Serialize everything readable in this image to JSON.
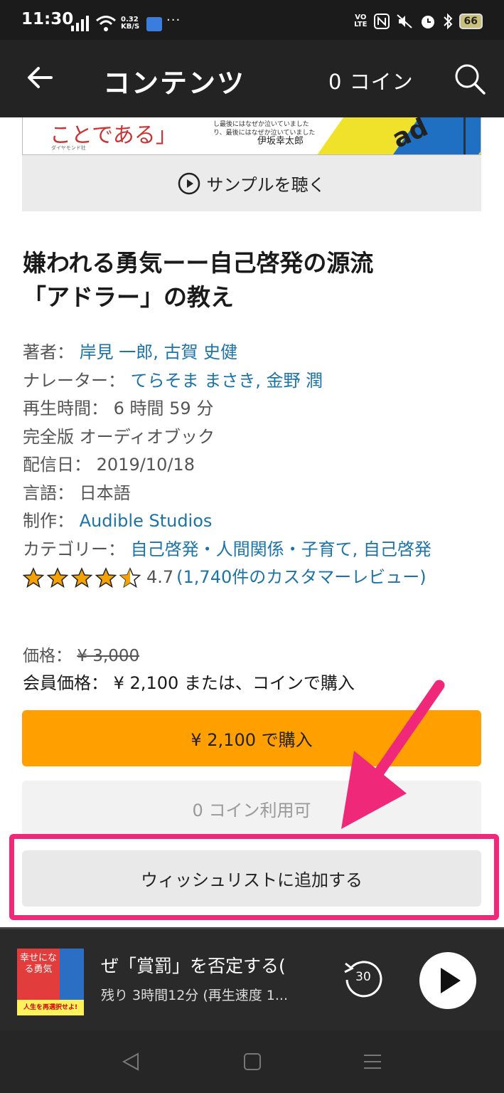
{
  "status_bar": {
    "time": "11:30",
    "net_speed_top": "0.32",
    "net_speed_bottom": "KB/S",
    "more": "···",
    "volte_top": "VO",
    "volte_bottom": "LTE",
    "battery": "66"
  },
  "header": {
    "title": "コンテンツ",
    "coins": "0 コイン"
  },
  "cover": {
    "big_text": "ことである」",
    "small_text": "ダイヤモンド社",
    "mid_text_1": "し最後にはなぜか泣いていました",
    "mid_text_2": "り、最後にはなぜか泣いていました",
    "author": "伊坂幸太郎",
    "logo_text": "ad"
  },
  "sample_button": "サンプルを聴く",
  "book": {
    "title_line1": "嫌われる勇気ーー自己啓発の源流",
    "title_line2": "「アドラー」の教え"
  },
  "details": {
    "author_label": "著者：",
    "authors": "岸見 一郎, 古賀 史健",
    "narrator_label": "ナレーター：",
    "narrators": "てらそま まさき, 金野 潤",
    "length_label": "再生時間：",
    "length": "6 時間 59 分",
    "format": "完全版 オーディオブック",
    "release_label": "配信日：",
    "release": "2019/10/18",
    "language_label": "言語：",
    "language": "日本語",
    "publisher_label": "制作：",
    "publisher": "Audible Studios",
    "category_label": "カテゴリー：",
    "categories": "自己啓発・人間関係・子育て, 自己啓発",
    "rating_value": "4.7",
    "rating": 4.7,
    "reviews": "(1,740件のカスタマーレビュー)"
  },
  "price": {
    "label": "価格：",
    "list_price": "¥ 3,000",
    "member_label": "会員価格：",
    "member_text": "¥ 2,100 または、コインで購入"
  },
  "buttons": {
    "buy": "¥ 2,100 で購入",
    "coins": "0 コイン利用可",
    "wishlist": "ウィッシュリストに追加する"
  },
  "player": {
    "thumb_text": "幸せになる勇気",
    "thumb_sub": "人生を再選択せよ!",
    "title": "ぜ「賞罰」を否定する(",
    "subtitle": "残り 3時間12分 (再生速度 1...",
    "rewind": "30"
  },
  "colors": {
    "accent_orange": "#ffa000",
    "link_blue": "#1c73a8",
    "highlight_pink": "#f0287a",
    "header_bg": "#232323"
  }
}
